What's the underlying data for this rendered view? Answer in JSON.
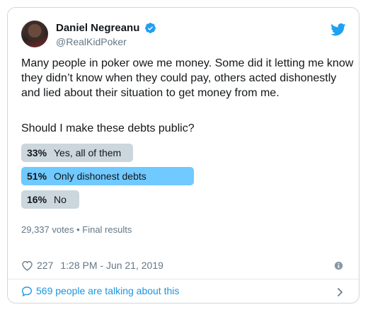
{
  "tweet": {
    "author_name": "Daniel Negreanu",
    "handle": "@RealKidPoker",
    "body": "Many people in poker owe me money. Some did it letting me know they didn’t know when they could pay, others acted dishonestly and lied about their situation to get money from me.",
    "question": "Should I make these debts public?"
  },
  "poll": {
    "options": [
      {
        "percent": "33%",
        "label": "Yes, all of them",
        "value": 0.33,
        "winner": false
      },
      {
        "percent": "51%",
        "label": "Only dishonest debts",
        "value": 0.51,
        "winner": true
      },
      {
        "percent": "16%",
        "label": "No",
        "value": 0.16,
        "winner": false
      }
    ],
    "votes_text": "29,337 votes",
    "separator": "•",
    "status": "Final results"
  },
  "footer": {
    "likes": "227",
    "timestamp": "1:28 PM - Jun 21, 2019",
    "talking": "569 people are talking about this"
  },
  "colors": {
    "accent": "#1da1f2",
    "link": "#1b95e0",
    "winner_bar": "#70c9ff",
    "loser_bar": "#ccd6dd",
    "muted": "#657786"
  },
  "icons": {
    "verified": "verified-badge-icon",
    "brand": "twitter-bird-icon",
    "like": "heart-icon",
    "info": "info-icon",
    "reply": "speech-bubble-icon",
    "more": "chevron-right-icon"
  }
}
